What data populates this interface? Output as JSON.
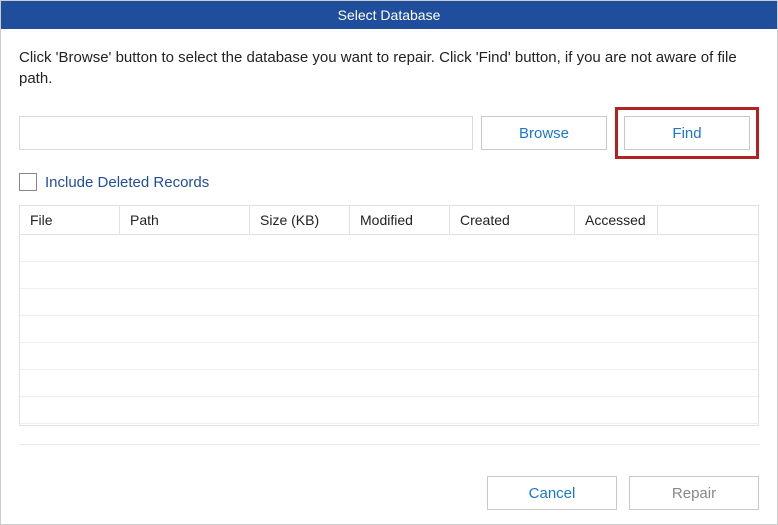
{
  "title": "Select Database",
  "instructions": "Click 'Browse' button to select the database you want to repair. Click 'Find' button, if you are not aware of file path.",
  "pathInput": {
    "value": "",
    "placeholder": ""
  },
  "buttons": {
    "browse": "Browse",
    "find": "Find",
    "cancel": "Cancel",
    "repair": "Repair"
  },
  "checkbox": {
    "includeDeleted": {
      "label": "Include Deleted Records",
      "checked": false
    }
  },
  "table": {
    "columns": [
      "File",
      "Path",
      "Size (KB)",
      "Modified",
      "Created",
      "Accessed",
      ""
    ],
    "rows": []
  }
}
